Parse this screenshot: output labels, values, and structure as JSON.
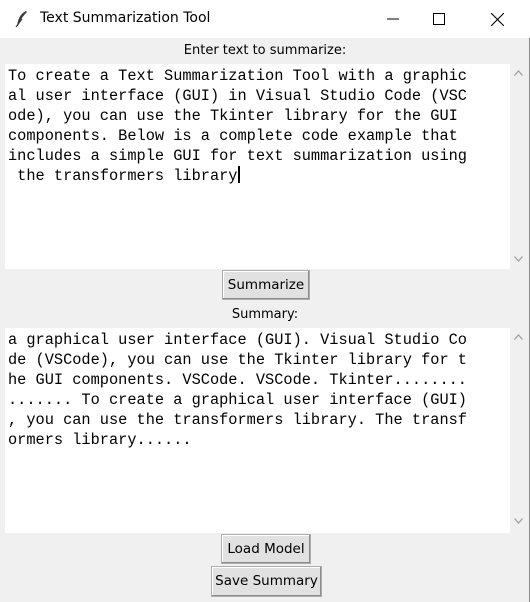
{
  "window": {
    "title": "Text Summarization Tool"
  },
  "input": {
    "label": "Enter text to summarize:",
    "lines": [
      "To create a Text Summarization Tool with a graphic",
      "al user interface (GUI) in Visual Studio Code (VSC",
      "ode), you can use the Tkinter library for the GUI",
      "components. Below is a complete code example that",
      "includes a simple GUI for text summarization using",
      " the transformers library"
    ]
  },
  "buttons": {
    "summarize": "Summarize",
    "load_model": "Load Model",
    "save_summary": "Save Summary"
  },
  "summary": {
    "label": "Summary:",
    "lines": [
      "a graphical user interface (GUI). Visual Studio Co",
      "de (VSCode), you can use the Tkinter library for t",
      "he GUI components. VSCode. VSCode. Tkinter........",
      "....... To create a graphical user interface (GUI)",
      ", you can use the transformers library. The transf",
      "ormers library......"
    ]
  },
  "icons": {
    "app": "feather-icon",
    "minimize": "minimize-icon",
    "maximize": "maximize-icon",
    "close": "close-icon"
  }
}
